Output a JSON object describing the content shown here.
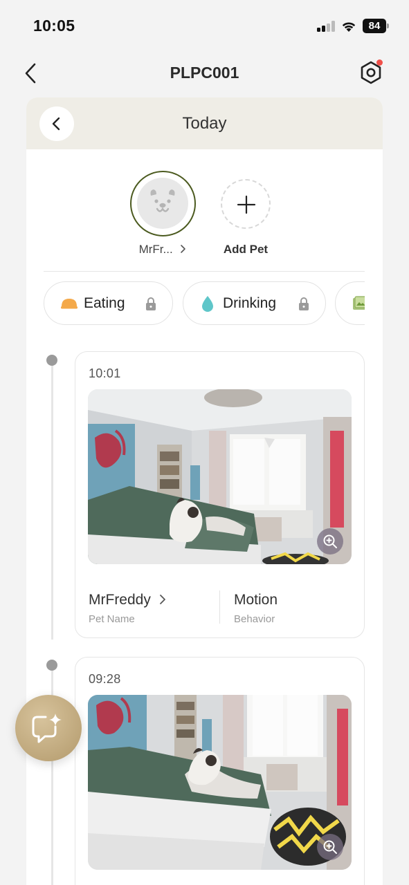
{
  "status_bar": {
    "time": "10:05",
    "battery": "84"
  },
  "nav": {
    "title": "PLPC001"
  },
  "header": {
    "title": "Today"
  },
  "pets": {
    "current_pet_label": "MrFr...",
    "add_pet_label": "Add Pet"
  },
  "chips": [
    {
      "label": "Eating",
      "icon": "food-bowl-icon",
      "locked": true
    },
    {
      "label": "Drinking",
      "icon": "water-drop-icon",
      "locked": true
    },
    {
      "label": "",
      "icon": "photo-icon",
      "locked": false
    }
  ],
  "events": [
    {
      "time": "10:01",
      "pet_name": "MrFreddy",
      "pet_name_caption": "Pet Name",
      "behavior": "Motion",
      "behavior_caption": "Behavior"
    },
    {
      "time": "09:28"
    }
  ],
  "colors": {
    "accent_ring": "#4b5a1f",
    "header_bg": "#efede6",
    "fab_gold": "#c3ab7f",
    "notification_dot": "#f0504a",
    "eating_orange": "#f4a94a",
    "drinking_teal": "#5fc6c9"
  }
}
